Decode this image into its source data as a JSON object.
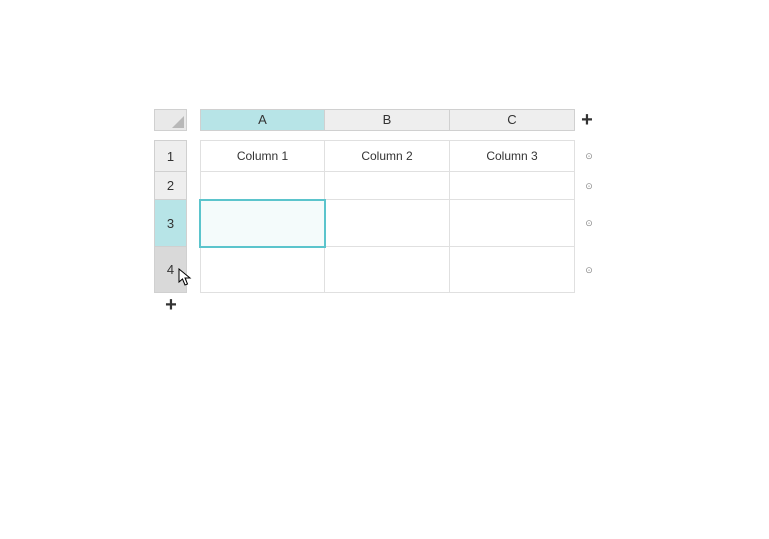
{
  "columns": {
    "headers": [
      "A",
      "B",
      "C"
    ],
    "selected_index": 0
  },
  "rows": {
    "headers": [
      "1",
      "2",
      "3",
      "4"
    ],
    "selected_index": 2,
    "hover_index": 3
  },
  "cells": {
    "r1c1": "Column 1",
    "r1c2": "Column 2",
    "r1c3": "Column 3"
  },
  "selection": {
    "row": 3,
    "col": "A"
  },
  "icons": {
    "plus": "+",
    "row_menu": "⊙"
  }
}
